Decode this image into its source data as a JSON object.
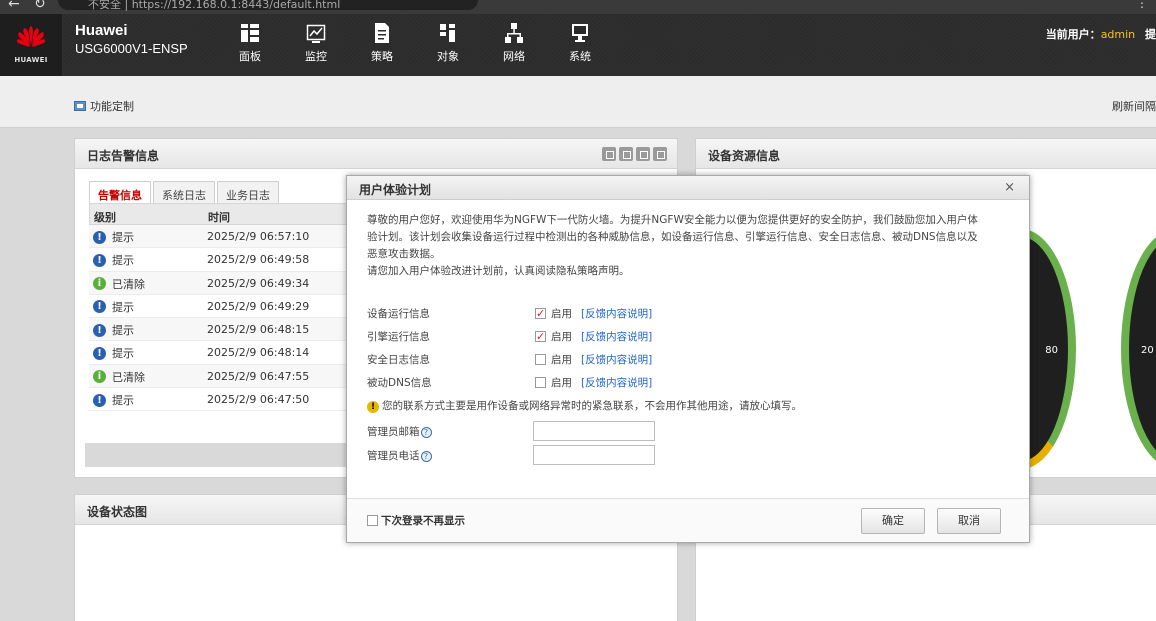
{
  "browser": {
    "url_text": "不安全 | https://192.168.0.1:8443/default.html"
  },
  "header": {
    "logo_text": "HUAWEI",
    "brand_line1": "Huawei",
    "brand_line2": "USG6000V1-ENSP",
    "nav": [
      {
        "label": "面板",
        "icon": "dashboard-icon"
      },
      {
        "label": "监控",
        "icon": "monitor-chart-icon"
      },
      {
        "label": "策略",
        "icon": "policy-document-icon"
      },
      {
        "label": "对象",
        "icon": "object-icon"
      },
      {
        "label": "网络",
        "icon": "network-icon"
      },
      {
        "label": "系统",
        "icon": "system-monitor-icon"
      }
    ],
    "user_label": "当前用户：",
    "user_name": "admin",
    "user_extra": "提"
  },
  "subbar": {
    "func_label": "功能定制",
    "refresh_label": "刷新间隔"
  },
  "log_panel": {
    "title": "日志告警信息",
    "tabs": [
      "告警信息",
      "系统日志",
      "业务日志"
    ],
    "columns": [
      "级别",
      "时间"
    ],
    "rows": [
      {
        "level": "提示",
        "type": "info",
        "time": "2025/2/9 06:57:10"
      },
      {
        "level": "提示",
        "type": "info",
        "time": "2025/2/9 06:49:58"
      },
      {
        "level": "已清除",
        "type": "cleared",
        "time": "2025/2/9 06:49:34"
      },
      {
        "level": "提示",
        "type": "info",
        "time": "2025/2/9 06:49:29"
      },
      {
        "level": "提示",
        "type": "info",
        "time": "2025/2/9 06:48:15"
      },
      {
        "level": "提示",
        "type": "info",
        "time": "2025/2/9 06:48:14"
      },
      {
        "level": "已清除",
        "type": "cleared",
        "time": "2025/2/9 06:47:55"
      },
      {
        "level": "提示",
        "type": "info",
        "time": "2025/2/9 06:47:50"
      }
    ]
  },
  "resource_panel": {
    "title": "设备资源信息",
    "gauge_labels": [
      "80",
      "20"
    ]
  },
  "status_panel": {
    "title": "设备状态图"
  },
  "modal": {
    "title": "用户体验计划",
    "close_glyph": "×",
    "intro_1": "尊敬的用户您好，欢迎使用华为NGFW下一代防火墙。为提升NGFW安全能力以便为您提供更好的安全防护，我们鼓励您加入用户体",
    "intro_2": "验计划。该计划会收集设备运行过程中检测出的各种威胁信息，如设备运行信息、引擎运行信息、安全日志信息、被动DNS信息以及",
    "intro_3": "恶意攻击数据。",
    "intro_4": "请您加入用户体验改进计划前，认真阅读隐私策略声明。",
    "options": [
      {
        "label": "设备运行信息",
        "enable": "启用",
        "link": "[反馈内容说明]",
        "checked": true
      },
      {
        "label": "引擎运行信息",
        "enable": "启用",
        "link": "[反馈内容说明]",
        "checked": true
      },
      {
        "label": "安全日志信息",
        "enable": "启用",
        "link": "[反馈内容说明]",
        "checked": false
      },
      {
        "label": "被动DNS信息",
        "enable": "启用",
        "link": "[反馈内容说明]",
        "checked": false
      }
    ],
    "contact_note": "您的联系方式主要是用作设备或网络异常时的紧急联系，不会用作其他用途，请放心填写。",
    "email_label": "管理员邮箱",
    "phone_label": "管理员电话",
    "email_value": "",
    "phone_value": "",
    "dont_show": "下次登录不再显示",
    "ok": "确定",
    "cancel": "取消"
  }
}
